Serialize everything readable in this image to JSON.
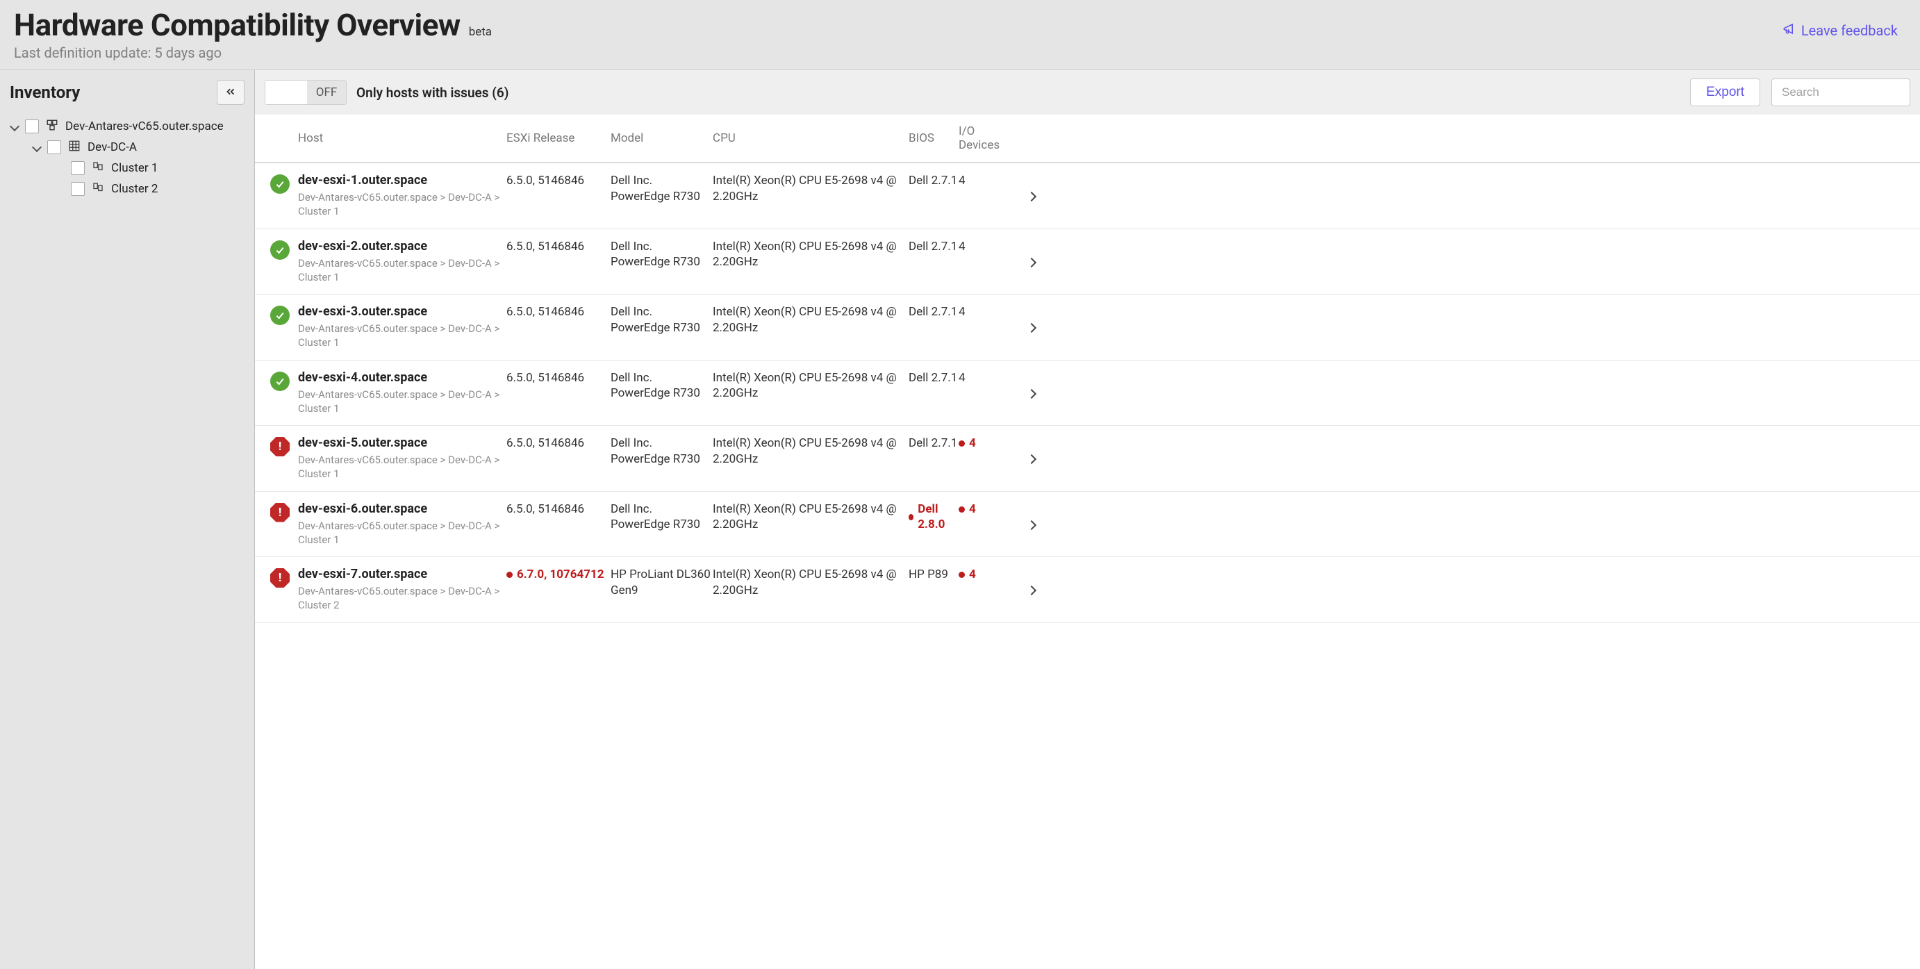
{
  "header": {
    "title": "Hardware Compatibility Overview",
    "badge": "beta",
    "subtitle": "Last definition update: 5 days ago",
    "feedback_label": "Leave feedback"
  },
  "sidebar": {
    "title": "Inventory",
    "tree": {
      "root": {
        "label": "Dev-Antares-vC65.outer.space"
      },
      "dc": {
        "label": "Dev-DC-A"
      },
      "clusters": [
        {
          "label": "Cluster 1"
        },
        {
          "label": "Cluster 2"
        }
      ]
    }
  },
  "toolbar": {
    "toggle_off": "OFF",
    "filter_label": "Only hosts with issues (6)",
    "export_label": "Export",
    "search_placeholder": "Search"
  },
  "table": {
    "columns": {
      "host": "Host",
      "esxi": "ESXi Release",
      "model": "Model",
      "cpu": "CPU",
      "bios": "BIOS",
      "io": "I/O Devices"
    },
    "rows": [
      {
        "status": "ok",
        "host": "dev-esxi-1.outer.space",
        "breadcrumb": "Dev-Antares-vC65.outer.space > Dev-DC-A > Cluster 1",
        "esxi": "6.5.0, 5146846",
        "esxi_flag": false,
        "model": "Dell Inc. PowerEdge R730",
        "cpu": "Intel(R) Xeon(R) CPU E5-2698 v4 @ 2.20GHz",
        "bios": "Dell 2.7.1",
        "bios_flag": false,
        "io": "4",
        "io_flag": false
      },
      {
        "status": "ok",
        "host": "dev-esxi-2.outer.space",
        "breadcrumb": "Dev-Antares-vC65.outer.space > Dev-DC-A > Cluster 1",
        "esxi": "6.5.0, 5146846",
        "esxi_flag": false,
        "model": "Dell Inc. PowerEdge R730",
        "cpu": "Intel(R) Xeon(R) CPU E5-2698 v4 @ 2.20GHz",
        "bios": "Dell 2.7.1",
        "bios_flag": false,
        "io": "4",
        "io_flag": false
      },
      {
        "status": "ok",
        "host": "dev-esxi-3.outer.space",
        "breadcrumb": "Dev-Antares-vC65.outer.space > Dev-DC-A > Cluster 1",
        "esxi": "6.5.0, 5146846",
        "esxi_flag": false,
        "model": "Dell Inc. PowerEdge R730",
        "cpu": "Intel(R) Xeon(R) CPU E5-2698 v4 @ 2.20GHz",
        "bios": "Dell 2.7.1",
        "bios_flag": false,
        "io": "4",
        "io_flag": false
      },
      {
        "status": "ok",
        "host": "dev-esxi-4.outer.space",
        "breadcrumb": "Dev-Antares-vC65.outer.space > Dev-DC-A > Cluster 1",
        "esxi": "6.5.0, 5146846",
        "esxi_flag": false,
        "model": "Dell Inc. PowerEdge R730",
        "cpu": "Intel(R) Xeon(R) CPU E5-2698 v4 @ 2.20GHz",
        "bios": "Dell 2.7.1",
        "bios_flag": false,
        "io": "4",
        "io_flag": false
      },
      {
        "status": "err",
        "host": "dev-esxi-5.outer.space",
        "breadcrumb": "Dev-Antares-vC65.outer.space > Dev-DC-A > Cluster 1",
        "esxi": "6.5.0, 5146846",
        "esxi_flag": false,
        "model": "Dell Inc. PowerEdge R730",
        "cpu": "Intel(R) Xeon(R) CPU E5-2698 v4 @ 2.20GHz",
        "bios": "Dell 2.7.1",
        "bios_flag": false,
        "io": "4",
        "io_flag": true
      },
      {
        "status": "err",
        "host": "dev-esxi-6.outer.space",
        "breadcrumb": "Dev-Antares-vC65.outer.space > Dev-DC-A > Cluster 1",
        "esxi": "6.5.0, 5146846",
        "esxi_flag": false,
        "model": "Dell Inc. PowerEdge R730",
        "cpu": "Intel(R) Xeon(R) CPU E5-2698 v4 @ 2.20GHz",
        "bios": "Dell 2.8.0",
        "bios_flag": true,
        "io": "4",
        "io_flag": true
      },
      {
        "status": "err",
        "host": "dev-esxi-7.outer.space",
        "breadcrumb": "Dev-Antares-vC65.outer.space > Dev-DC-A > Cluster 2",
        "esxi": "6.7.0, 10764712",
        "esxi_flag": true,
        "model": "HP ProLiant DL360 Gen9",
        "cpu": "Intel(R) Xeon(R) CPU E5-2698 v4 @ 2.20GHz",
        "bios": "HP P89",
        "bios_flag": false,
        "io": "4",
        "io_flag": true
      }
    ]
  }
}
